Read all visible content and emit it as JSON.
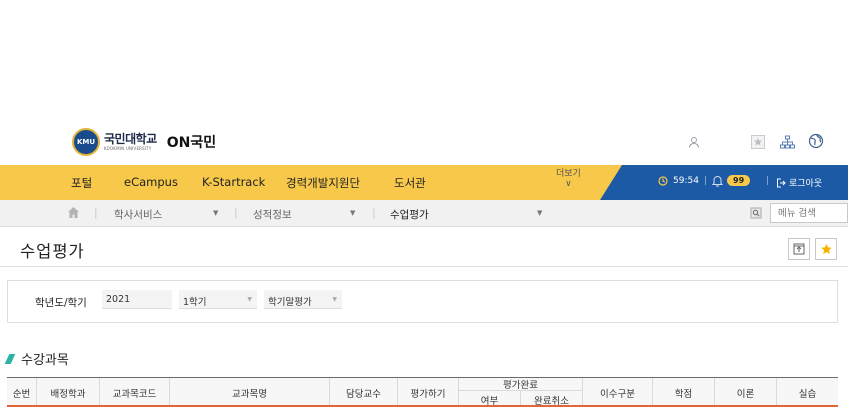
{
  "header": {
    "logo_emblem": "KMU",
    "logo_kr": "국민대학교",
    "logo_en": "KOOKMIN UNIVERSITY",
    "logo_on": "ON국민"
  },
  "nav": {
    "items": [
      "포털",
      "eCampus",
      "K-Startrack",
      "경력개발지원단",
      "도서관"
    ],
    "more_label": "더보기",
    "timer": "59:54",
    "badge_count": "99",
    "logout_label": "로그아웃"
  },
  "breadcrumb": {
    "items": [
      "학사서비스",
      "성적정보",
      "수업평가"
    ],
    "search_placeholder": "메뉴 검색"
  },
  "page": {
    "title": "수업평가"
  },
  "filter": {
    "label": "학년도/학기",
    "year": "2021",
    "semester": "1학기",
    "eval_type": "학기말평가"
  },
  "section": {
    "title": "수강과목"
  },
  "table": {
    "headers": {
      "no": "순번",
      "dept": "배정학과",
      "code": "교과목코드",
      "name": "교과목명",
      "prof": "담당교수",
      "eval": "평가하기",
      "done_group": "평가완료",
      "done_yes": "여부",
      "done_cancel": "완료취소",
      "category": "이수구분",
      "credit": "학점",
      "theory": "이론",
      "practice": "실습"
    }
  }
}
